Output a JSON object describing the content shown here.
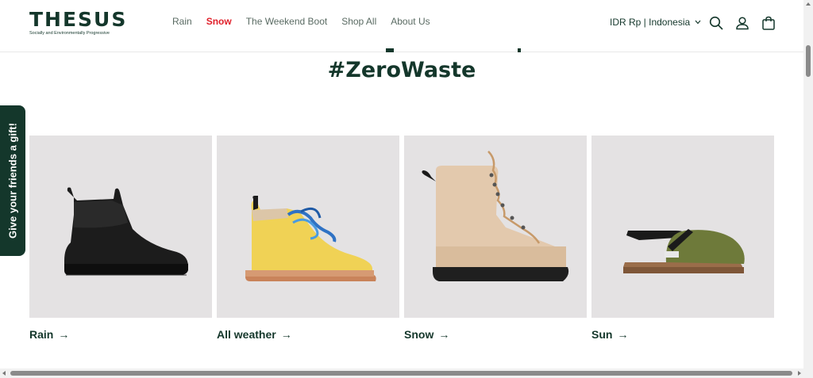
{
  "brand": {
    "name": "THESUS",
    "tagline": "Socially and Environmentally Progressive"
  },
  "nav": [
    {
      "label": "Rain",
      "active": false
    },
    {
      "label": "Snow",
      "active": true
    },
    {
      "label": "The Weekend Boot",
      "active": false
    },
    {
      "label": "Shop All",
      "active": false
    },
    {
      "label": "About Us",
      "active": false
    }
  ],
  "locale": {
    "label": "IDR Rp | Indonesia"
  },
  "header_icons": [
    "search-icon",
    "account-icon",
    "cart-icon"
  ],
  "section": {
    "heading": "#ZeroWaste"
  },
  "gift_tab": {
    "label": "Give your friends a gift!"
  },
  "categories": [
    {
      "label": "Rain",
      "arrow": "→"
    },
    {
      "label": "All weather",
      "arrow": "→"
    },
    {
      "label": "Snow",
      "arrow": "→"
    },
    {
      "label": "Sun",
      "arrow": "→"
    }
  ],
  "colors": {
    "brand_green": "#14372b",
    "active_red": "#e0202a",
    "card_bg": "#e4e2e3"
  }
}
